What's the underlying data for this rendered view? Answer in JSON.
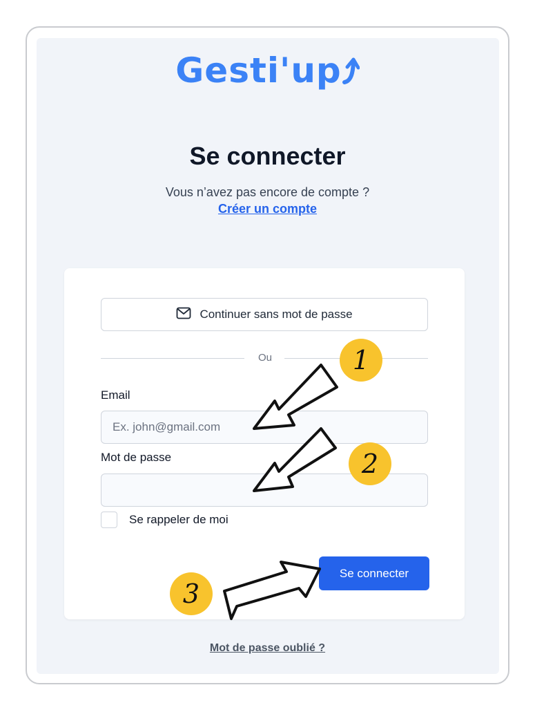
{
  "brand": {
    "name": "Gesti'up",
    "logo_color": "#3b82f6"
  },
  "login": {
    "title": "Se connecter",
    "subtitle": "Vous n’avez pas encore de compte ?",
    "create_account_link": "Créer un compte",
    "magic_link_button": "Continuer sans mot de passe",
    "divider": "Ou",
    "email_label": "Email",
    "email_placeholder": "Ex. john@gmail.com",
    "email_value": "",
    "password_label": "Mot de passe",
    "password_value": "",
    "remember_me_label": "Se rappeler de moi",
    "remember_me_checked": false,
    "submit_label": "Se connecter",
    "forgot_password_link": "Mot de passe oublié ?",
    "accent_color": "#2563eb"
  },
  "annotations": {
    "badges": [
      "1",
      "2",
      "3"
    ],
    "badge_color": "#f8c32d",
    "icons": [
      "envelope-icon",
      "arrow-up-icon"
    ]
  }
}
